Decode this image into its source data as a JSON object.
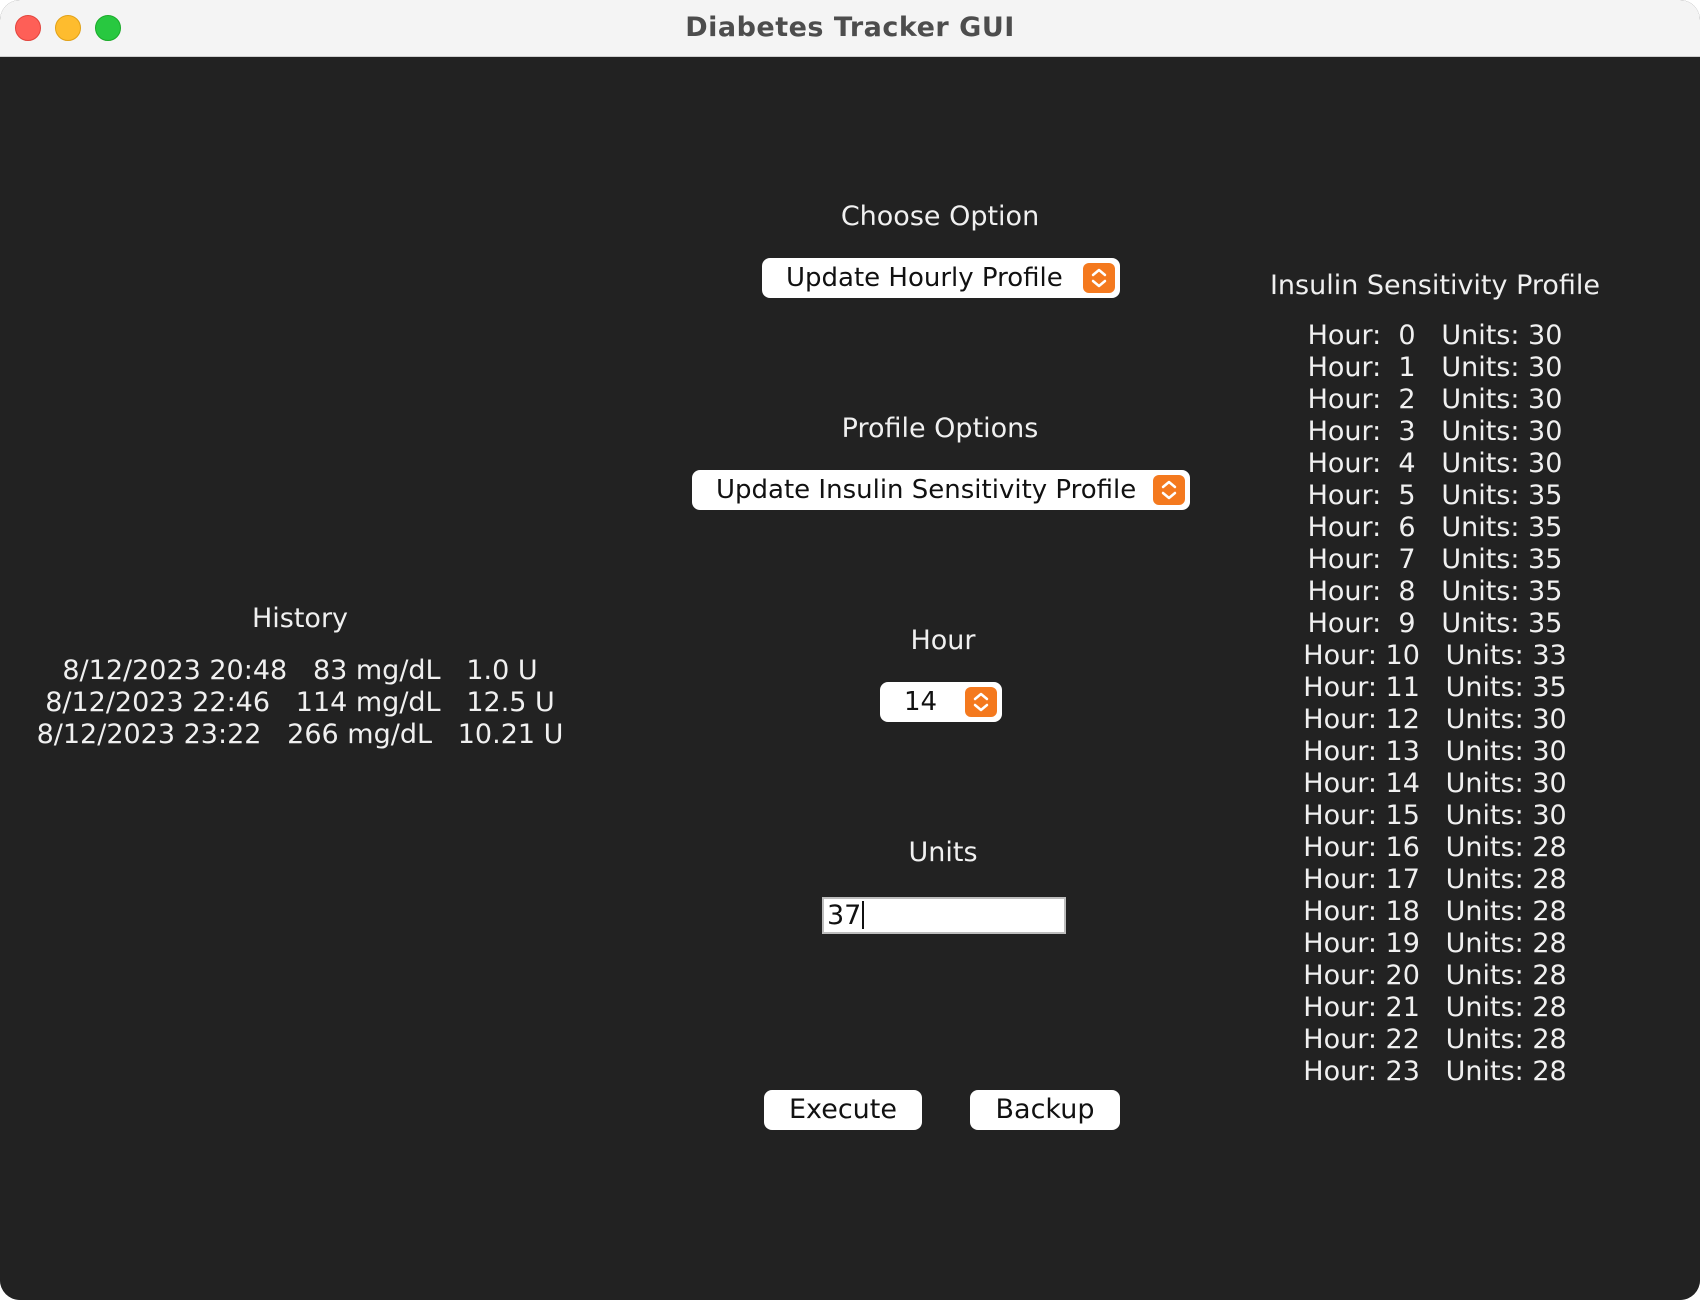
{
  "window": {
    "title": "Diabetes Tracker GUI"
  },
  "colors": {
    "background": "#222222",
    "accent": "#f4791e",
    "text": "#f0f0f0"
  },
  "choose_option": {
    "label": "Choose Option",
    "selected": "Update Hourly Profile"
  },
  "profile_options": {
    "label": "Profile Options",
    "selected": "Update Insulin Sensitivity Profile"
  },
  "hour": {
    "label": "Hour",
    "selected": "14"
  },
  "units": {
    "label": "Units",
    "value": "37"
  },
  "buttons": {
    "execute": "Execute",
    "backup": "Backup"
  },
  "history": {
    "title": "History",
    "entries": [
      "8/12/2023 20:48   83 mg/dL   1.0 U",
      "8/12/2023 22:46   114 mg/dL   12.5 U",
      "8/12/2023 23:22   266 mg/dL   10.21 U"
    ]
  },
  "sensitivity_profile": {
    "title": "Insulin Sensitivity Profile",
    "rows": [
      "Hour:  0   Units: 30",
      "Hour:  1   Units: 30",
      "Hour:  2   Units: 30",
      "Hour:  3   Units: 30",
      "Hour:  4   Units: 30",
      "Hour:  5   Units: 35",
      "Hour:  6   Units: 35",
      "Hour:  7   Units: 35",
      "Hour:  8   Units: 35",
      "Hour:  9   Units: 35",
      "Hour: 10   Units: 33",
      "Hour: 11   Units: 35",
      "Hour: 12   Units: 30",
      "Hour: 13   Units: 30",
      "Hour: 14   Units: 30",
      "Hour: 15   Units: 30",
      "Hour: 16   Units: 28",
      "Hour: 17   Units: 28",
      "Hour: 18   Units: 28",
      "Hour: 19   Units: 28",
      "Hour: 20   Units: 28",
      "Hour: 21   Units: 28",
      "Hour: 22   Units: 28",
      "Hour: 23   Units: 28"
    ]
  }
}
